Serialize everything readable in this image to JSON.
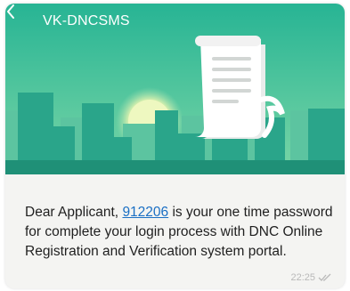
{
  "header": {
    "back_icon": "chevron-left-icon",
    "sender": "VK-DNCSMS"
  },
  "banner": {
    "illustration": "city-skyline-with-document-scroll",
    "colors": {
      "sky_top": "#29b796",
      "sky_bottom": "#6ccfa2",
      "sun": "#e9f5b6",
      "buildings_back": "#5ec5a0",
      "buildings_front": "#2ba58b",
      "ground": "#1f8e76"
    }
  },
  "message": {
    "prefix": "Dear Applicant, ",
    "otp": "912206",
    "suffix": " is your one time password for complete your login process with DNC Online Registration and Verification system portal."
  },
  "status": {
    "time": "22:25",
    "ticks_icon": "double-check-icon"
  }
}
